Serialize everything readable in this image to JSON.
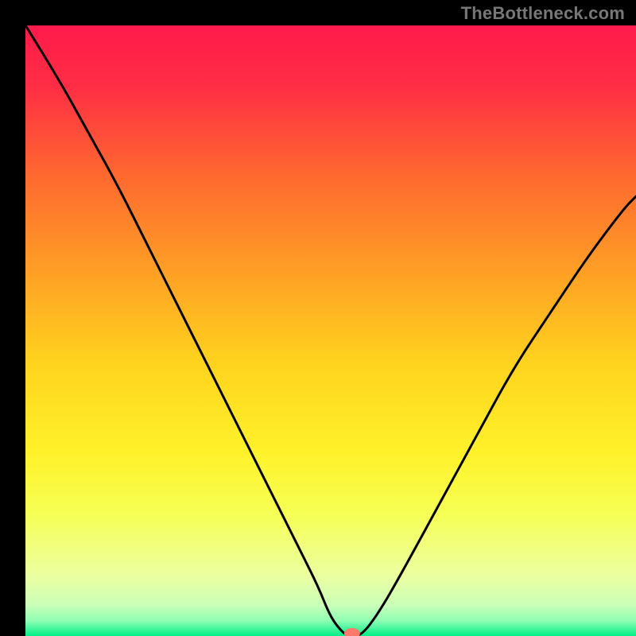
{
  "watermark": "TheBottleneck.com",
  "chart_data": {
    "type": "line",
    "title": "",
    "xlabel": "",
    "ylabel": "",
    "xlim": [
      0,
      100
    ],
    "ylim": [
      0,
      100
    ],
    "background": {
      "type": "vertical-gradient",
      "stops": [
        {
          "pos": 0.0,
          "color": "#ff1a4b"
        },
        {
          "pos": 0.1,
          "color": "#ff2e44"
        },
        {
          "pos": 0.25,
          "color": "#ff6a2f"
        },
        {
          "pos": 0.4,
          "color": "#ff9e25"
        },
        {
          "pos": 0.55,
          "color": "#ffd21e"
        },
        {
          "pos": 0.7,
          "color": "#fff22a"
        },
        {
          "pos": 0.8,
          "color": "#f6ff55"
        },
        {
          "pos": 0.9,
          "color": "#ecffa0"
        },
        {
          "pos": 0.95,
          "color": "#c9ffb8"
        },
        {
          "pos": 0.975,
          "color": "#8effb3"
        },
        {
          "pos": 1.0,
          "color": "#00ef86"
        }
      ]
    },
    "series": [
      {
        "name": "bottleneck-curve",
        "color": "#000000",
        "x": [
          0,
          5,
          10,
          15,
          20,
          25,
          30,
          35,
          40,
          45,
          48,
          50,
          52,
          53,
          55,
          58,
          62,
          68,
          74,
          80,
          86,
          92,
          98,
          100
        ],
        "y": [
          100,
          92,
          83,
          74,
          64,
          54,
          44,
          34,
          24,
          14,
          8,
          3,
          0.5,
          0,
          0,
          4,
          11,
          22,
          33,
          44,
          53,
          62,
          70,
          72
        ]
      }
    ],
    "marker": {
      "name": "optimum-marker",
      "x": 53.5,
      "y": 0,
      "color": "#ff7a6a",
      "rx": 10,
      "ry": 7
    }
  }
}
